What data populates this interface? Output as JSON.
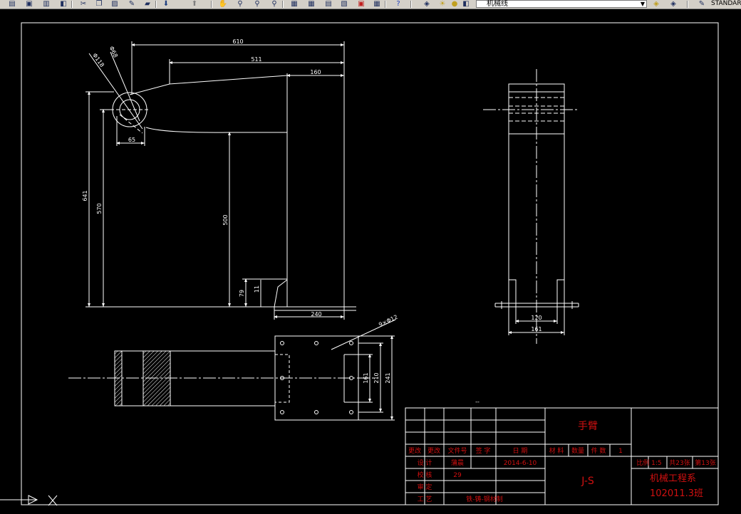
{
  "toolbar": {
    "layer_name": "机械线",
    "text_style": "STANDARD",
    "icons": [
      "open-icon",
      "save-icon",
      "print-icon",
      "preview-icon",
      "cut-icon",
      "copy-icon",
      "paste-icon",
      "match-icon",
      "undo-icon",
      "redo-icon",
      "pan-icon",
      "zoom-realtime-icon",
      "zoom-window-icon",
      "zoom-previous-icon",
      "properties-icon",
      "design-center-icon",
      "tool-palettes-icon",
      "sheet-set-icon",
      "markup-icon",
      "calculator-icon",
      "help-icon",
      "layer-manager-icon",
      "layer-state-icon"
    ]
  },
  "dimensions": {
    "d610": "610",
    "d511": "511",
    "d160": "160",
    "d65": "65",
    "d641": "641",
    "d570": "570",
    "d500": "500",
    "d79": "79",
    "d11": "11",
    "d240": "240",
    "phi118": "Φ118",
    "phi68": "Φ68",
    "d120": "120",
    "d161": "161",
    "holes": "9×Φ12",
    "d161v": "161",
    "d210": "210",
    "d241": "241",
    "small_mark": "--"
  },
  "title_block": {
    "part_name": "手臂",
    "drawing_no": "J-S",
    "header": [
      "更改",
      "更改",
      "文件号",
      "签 字",
      "日      期",
      "材 料",
      "数量",
      "件 数",
      "1"
    ],
    "rows": [
      {
        "label": "设   计",
        "name": "蒲晨",
        "date": "2014-6-10"
      },
      {
        "label": "校   核",
        "name": "29",
        "date": ""
      },
      {
        "label": "审   定",
        "name": "",
        "date": ""
      },
      {
        "label": "工   艺",
        "name": "铁-铸-钢材制",
        "date": ""
      }
    ],
    "scale": "比例 1:5",
    "sheets": "共23张",
    "sheet_no": "第13张",
    "school": "机械工程系",
    "class": "102011.3班"
  },
  "colors": {
    "background": "#000000",
    "geometry": "#ffffff",
    "title_lines": "#ffffff",
    "title_text": "#d01010",
    "frame": "#ffffff"
  }
}
